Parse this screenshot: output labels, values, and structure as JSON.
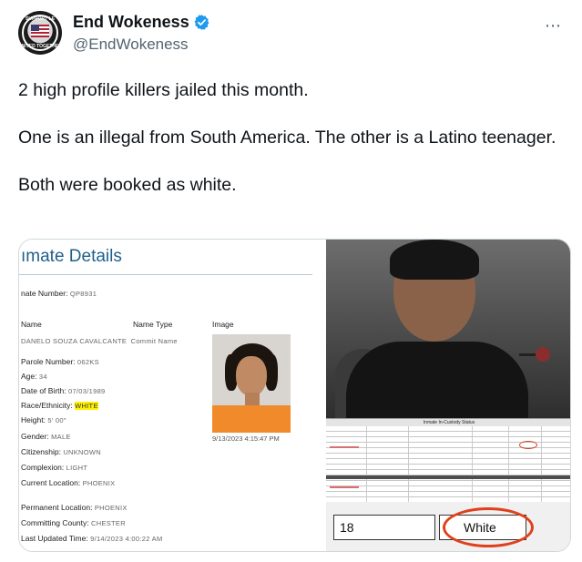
{
  "author": {
    "display_name": "End Wokeness",
    "handle": "@EndWokeness",
    "avatar_text_top": "SUPPORT LE",
    "avatar_text_bottom": "UNITED TOGETHER"
  },
  "more_icon": "⋯",
  "tweet": {
    "lines": [
      "2 high profile killers jailed this month.",
      "One is an illegal from South America. The other is a Latino teenager.",
      "Both were booked as white."
    ]
  },
  "media": {
    "left": {
      "title": "ımate Details",
      "inmate_number_label": "nate Number:",
      "inmate_number": "QP8931",
      "col_name": "Name",
      "col_name_type": "Name Type",
      "col_image": "Image",
      "name_value": "DANELO SOUZA CAVALCANTE",
      "name_type_value": "Commit Name",
      "image_date": "9/13/2023 4:15:47 PM",
      "fields": [
        {
          "label": "Parole Number:",
          "value": "062KS"
        },
        {
          "label": "Age:",
          "value": "34"
        },
        {
          "label": "Date of Birth:",
          "value": "07/03/1989"
        },
        {
          "label": "Race/Ethnicity:",
          "value": "WHITE"
        },
        {
          "label": "Height:",
          "value": "5' 00\""
        },
        {
          "label": "Gender:",
          "value": "MALE"
        },
        {
          "label": "Citizenship:",
          "value": "UNKNOWN"
        },
        {
          "label": "Complexion:",
          "value": "LIGHT"
        },
        {
          "label": "Current Location:",
          "value": "PHOENIX"
        },
        {
          "label": "Permanent Location:",
          "value": "PHOENIX"
        },
        {
          "label": "Committing County:",
          "value": "CHESTER"
        },
        {
          "label": "Last Updated Time:",
          "value": "9/14/2023 4:00:22 AM"
        }
      ]
    },
    "right": {
      "custody_title": "Inmate In-Custody Status",
      "age_cell": "18",
      "race_cell": "White"
    }
  },
  "colors": {
    "accent_blue": "#1d9bf0",
    "doc_title": "#1f5f8b",
    "highlight": "#fff200",
    "circle_red": "#e0401d"
  }
}
